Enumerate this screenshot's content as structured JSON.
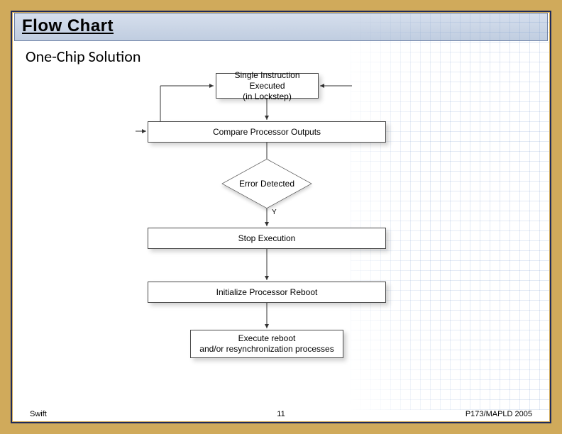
{
  "title": "Flow Chart",
  "subtitle": "One-Chip Solution",
  "flow": {
    "step1_line1": "Single Instruction Executed",
    "step1_line2": "(in Lockstep)",
    "step2": "Compare Processor Outputs",
    "decision": "Error Detected",
    "decision_y": "Y",
    "step3": "Stop Execution",
    "step4": "Initialize Processor Reboot",
    "step5_line1": "Execute reboot",
    "step5_line2": "and/or resynchronization processes"
  },
  "footer": {
    "left": "Swift",
    "center": "11",
    "right": "P173/MAPLD 2005"
  },
  "colors": {
    "frame": "#d0aa5b",
    "frame_inner": "#1e2a5a",
    "titlebar_bg": "#c9d4e6"
  }
}
